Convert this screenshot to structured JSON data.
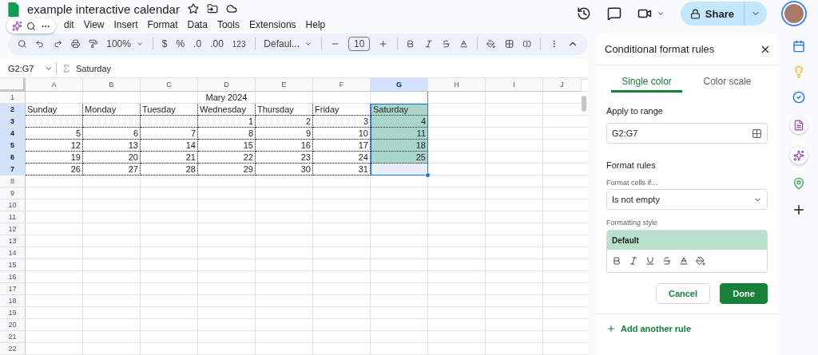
{
  "document": {
    "title": "example interactive calendar"
  },
  "menu": [
    "dit",
    "View",
    "Insert",
    "Format",
    "Data",
    "Tools",
    "Extensions",
    "Help"
  ],
  "share": {
    "label": "Share"
  },
  "toolbar": {
    "zoom": "100%",
    "currency": "$",
    "percent": "%",
    "decrease_decimals": ".0",
    "increase_decimals": ".00",
    "number_format": "123",
    "font": "Defaul...",
    "font_size": "10"
  },
  "formula_bar": {
    "cell_reference": "G2:G7",
    "content": "Saturday"
  },
  "sheet": {
    "columns": [
      {
        "label": "A",
        "selected": false
      },
      {
        "label": "B",
        "selected": false
      },
      {
        "label": "C",
        "selected": false
      },
      {
        "label": "D",
        "selected": false
      },
      {
        "label": "E",
        "selected": false
      },
      {
        "label": "F",
        "selected": false
      },
      {
        "label": "G",
        "selected": true
      },
      {
        "label": "H",
        "selected": false
      },
      {
        "label": "I",
        "selected": false
      },
      {
        "label": "J",
        "selected": false
      }
    ],
    "title_row": {
      "number": "1",
      "selected": false,
      "text": "Mary 2024"
    },
    "calendar_rows": [
      {
        "number": "2",
        "selected": true,
        "cells": [
          {
            "text": "Sunday",
            "highlighted": false
          },
          {
            "text": "Monday",
            "highlighted": false
          },
          {
            "text": "Tuesday",
            "highlighted": false
          },
          {
            "text": "Wednesday",
            "highlighted": false
          },
          {
            "text": "Thursday",
            "highlighted": false
          },
          {
            "text": "Friday",
            "highlighted": false
          },
          {
            "text": "Saturday",
            "highlighted": true
          }
        ]
      },
      {
        "number": "3",
        "selected": true,
        "cells": [
          {
            "text": "",
            "highlighted": false
          },
          {
            "text": "",
            "highlighted": false
          },
          {
            "text": "",
            "highlighted": false
          },
          {
            "text": "1",
            "highlighted": false
          },
          {
            "text": "2",
            "highlighted": false
          },
          {
            "text": "3",
            "highlighted": false
          },
          {
            "text": "4",
            "highlighted": true
          }
        ]
      },
      {
        "number": "4",
        "selected": true,
        "cells": [
          {
            "text": "5",
            "highlighted": false
          },
          {
            "text": "6",
            "highlighted": false
          },
          {
            "text": "7",
            "highlighted": false
          },
          {
            "text": "8",
            "highlighted": false
          },
          {
            "text": "9",
            "highlighted": false
          },
          {
            "text": "10",
            "highlighted": false
          },
          {
            "text": "11",
            "highlighted": true
          }
        ]
      },
      {
        "number": "5",
        "selected": true,
        "cells": [
          {
            "text": "12",
            "highlighted": false
          },
          {
            "text": "13",
            "highlighted": false
          },
          {
            "text": "14",
            "highlighted": false
          },
          {
            "text": "15",
            "highlighted": false
          },
          {
            "text": "16",
            "highlighted": false
          },
          {
            "text": "17",
            "highlighted": false
          },
          {
            "text": "18",
            "highlighted": true
          }
        ]
      },
      {
        "number": "6",
        "selected": true,
        "cells": [
          {
            "text": "19",
            "highlighted": false
          },
          {
            "text": "20",
            "highlighted": false
          },
          {
            "text": "21",
            "highlighted": false
          },
          {
            "text": "22",
            "highlighted": false
          },
          {
            "text": "23",
            "highlighted": false
          },
          {
            "text": "24",
            "highlighted": false
          },
          {
            "text": "25",
            "highlighted": true
          }
        ]
      },
      {
        "number": "7",
        "selected": true,
        "cells": [
          {
            "text": "26",
            "highlighted": false
          },
          {
            "text": "27",
            "highlighted": false
          },
          {
            "text": "28",
            "highlighted": false
          },
          {
            "text": "29",
            "highlighted": false
          },
          {
            "text": "30",
            "highlighted": false
          },
          {
            "text": "31",
            "highlighted": false
          },
          {
            "text": "",
            "highlighted": false
          }
        ]
      }
    ],
    "empty_rows": [
      {
        "number": "8",
        "selected": false
      },
      {
        "number": "9",
        "selected": false
      },
      {
        "number": "10",
        "selected": false
      },
      {
        "number": "11",
        "selected": false
      },
      {
        "number": "12",
        "selected": false
      },
      {
        "number": "13",
        "selected": false
      },
      {
        "number": "14",
        "selected": false
      },
      {
        "number": "15",
        "selected": false
      },
      {
        "number": "16",
        "selected": false
      },
      {
        "number": "17",
        "selected": false
      },
      {
        "number": "18",
        "selected": false
      },
      {
        "number": "19",
        "selected": false
      },
      {
        "number": "20",
        "selected": false
      },
      {
        "number": "21",
        "selected": false
      },
      {
        "number": "22",
        "selected": false
      }
    ]
  },
  "panel": {
    "title": "Conditional format rules",
    "tabs": [
      {
        "label": "Single color",
        "selected": true
      },
      {
        "label": "Color scale",
        "selected": false
      }
    ],
    "apply_label": "Apply to range",
    "range": "G2:G7",
    "rules_label": "Format rules",
    "condition_label": "Format cells if…",
    "condition": "Is not empty",
    "style_label": "Formatting style",
    "style_preview": "Default",
    "cancel": "Cancel",
    "done": "Done",
    "add_rule": "Add another rule"
  }
}
